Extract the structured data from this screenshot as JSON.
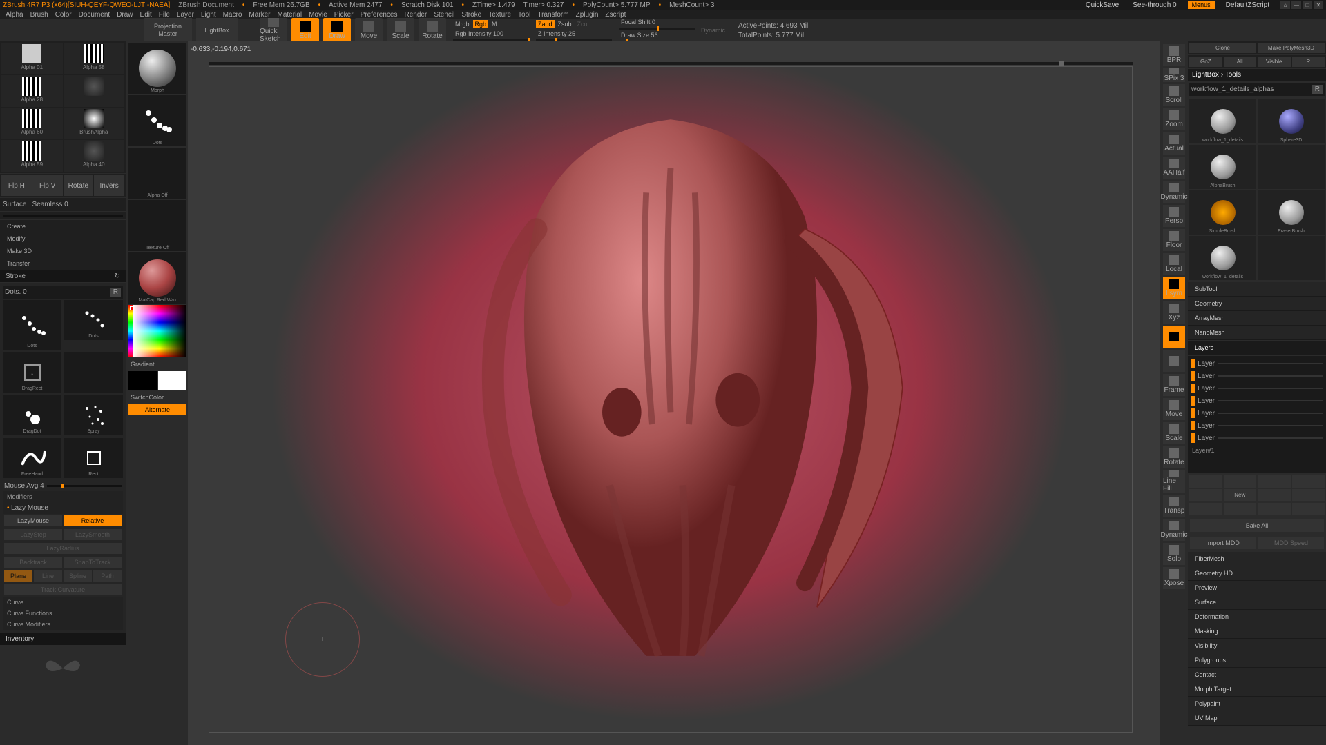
{
  "titlebar": {
    "app": "ZBrush 4R7 P3 (x64)[SIUH-QEYF-QWEO-LJTI-NAEA]",
    "doc": "ZBrush Document",
    "freemem": "Free Mem 26.7GB",
    "activemem": "Active Mem 2477",
    "scratch": "Scratch Disk 101",
    "ztime": "ZTime> 1.479",
    "timer": "Timer> 0.327",
    "polycount": "PolyCount> 5.777 MP",
    "meshcount": "MeshCount> 3",
    "quicksave": "QuickSave",
    "seethrough": "See-through   0",
    "menus": "Menus",
    "defaultzscript": "DefaultZScript"
  },
  "menubar": [
    "Alpha",
    "Brush",
    "Color",
    "Document",
    "Draw",
    "Edit",
    "File",
    "Layer",
    "Light",
    "Macro",
    "Marker",
    "Material",
    "Movie",
    "Picker",
    "Preferences",
    "Render",
    "Stencil",
    "Stroke",
    "Texture",
    "Tool",
    "Transform",
    "Zplugin",
    "Zscript"
  ],
  "toolbar": {
    "coords": "-0.633,-0.194,0.671",
    "projection": "Projection Master",
    "lightbox": "LightBox",
    "quicksketch": "Quick Sketch",
    "edit": "Edit",
    "draw": "Draw",
    "move": "Move",
    "scale": "Scale",
    "rotate": "Rotate",
    "mrgb": "Mrgb",
    "rgb": "Rgb",
    "m": "M",
    "rgbint": "Rgb Intensity 100",
    "zadd": "Zadd",
    "zsub": "Zsub",
    "zcut": "Zcut",
    "zint": "Z Intensity 25",
    "focal": "Focal Shift 0",
    "drawsize": "Draw Size 56",
    "dynamic": "Dynamic",
    "activepoints": "ActivePoints: 4.693 Mil",
    "totalpoints": "TotalPoints: 5.777 Mil"
  },
  "alphas": [
    {
      "name": "Alpha 01"
    },
    {
      "name": "Alpha 58"
    },
    {
      "name": "Alpha 28"
    },
    {
      "name": ""
    },
    {
      "name": "Alpha 60"
    },
    {
      "name": "BrushAlpha"
    },
    {
      "name": "Alpha 59"
    },
    {
      "name": "Alpha 40"
    }
  ],
  "flip": [
    "Flp H",
    "Flp V",
    "Rotate",
    "Invers"
  ],
  "surface": {
    "label": "Surface",
    "seamless": "Seamless 0"
  },
  "leftmenu": [
    "Create",
    "Modify",
    "Make 3D",
    "Transfer"
  ],
  "stroke": {
    "title": "Stroke",
    "dots": "Dots. 0",
    "r": "R",
    "types": [
      "Dots",
      "Dots",
      "DragDot",
      "Spray",
      "FreeHand",
      "Rect",
      "DragRect"
    ],
    "mouseavg": "Mouse Avg 4",
    "modifiers": "Modifiers",
    "lazymouse_h": "Lazy Mouse",
    "lazymouse": "LazyMouse",
    "relative": "Relative",
    "lazystep": "LazyStep",
    "lazysmooth": "LazySmooth",
    "lazyradius": "LazyRadius",
    "backtrack": "Backtrack",
    "snaptotrack": "SnapToTrack",
    "plane": "Plane",
    "line": "Line",
    "spline": "Spline",
    "path": "Path",
    "trackcurv": "Track Curvature",
    "curve": "Curve",
    "curvefn": "Curve Functions",
    "curvemod": "Curve Modifiers",
    "inventory": "Inventory"
  },
  "col2": {
    "morph": "Morph",
    "dots": "Dots",
    "alphaoff": "Alpha Off",
    "textureoff": "Texture Off",
    "matcap": "MatCap Red Wax",
    "gradient": "Gradient",
    "switchcolor": "SwitchColor",
    "alternate": "Alternate"
  },
  "rtray": [
    "BPR",
    "SPix 3",
    "Scroll",
    "Zoom",
    "Actual",
    "AAHalf",
    "Dynamic",
    "Persp",
    "Floor",
    "Local",
    "Lsym",
    "Xyz",
    "",
    "",
    "Frame",
    "Move",
    "Scale",
    "Rotate",
    "Line Fill",
    "Transp",
    "Dynamic",
    "Solo",
    "Xpose"
  ],
  "right": {
    "topbtns": [
      "GoZ",
      "All",
      "Visible",
      "R"
    ],
    "lightbox": "LightBox › Tools",
    "clone": "Clone",
    "makepoly": "Make PolyMesh3D",
    "toolname": "workflow_1_details_alphas",
    "r": "R",
    "tools": [
      {
        "cap": "workflow_1_details"
      },
      {
        "cap": "Sphere3D"
      },
      {
        "cap": "AlphaBrush"
      },
      {
        "cap": ""
      },
      {
        "cap": "SimpleBrush"
      },
      {
        "cap": "EraserBrush"
      },
      {
        "cap": "workflow_1_details"
      },
      {
        "cap": ""
      }
    ],
    "sections": [
      "SubTool",
      "Geometry",
      "ArrayMesh",
      "NanoMesh"
    ],
    "layers": "Layers",
    "layername": "Layer#1",
    "newbtn": "New",
    "bakeall": "Bake All",
    "importmdd": "Import MDD",
    "mddspeed": "MDD Speed",
    "more": [
      "FiberMesh",
      "Geometry HD",
      "Preview",
      "Surface",
      "Deformation",
      "Masking",
      "Visibility",
      "Polygroups",
      "Contact",
      "Morph Target",
      "Polypaint",
      "UV Map"
    ]
  }
}
